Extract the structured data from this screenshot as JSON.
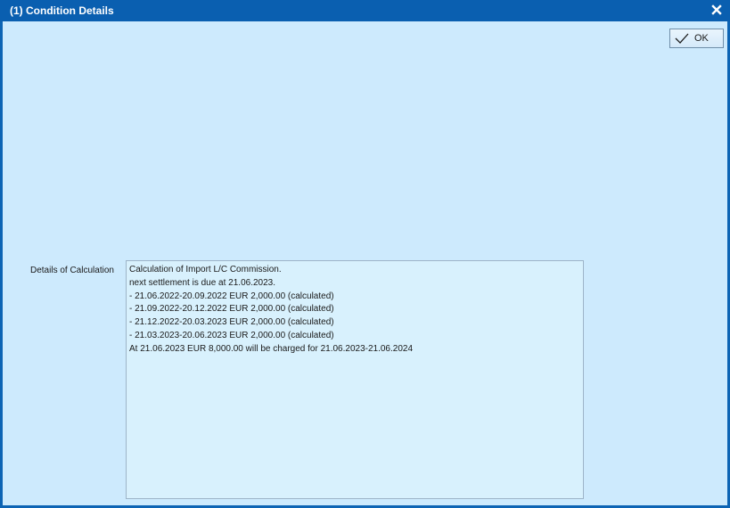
{
  "window": {
    "title": "(1) Condition Details"
  },
  "toolbar": {
    "ok_label": "OK"
  },
  "details": {
    "label": "Details of Calculation",
    "lines": [
      "Calculation of Import L/C Commission.",
      "next settlement is due at 21.06.2023.",
      "- 21.06.2022-20.09.2022 EUR 2,000.00 (calculated)",
      "- 21.09.2022-20.12.2022 EUR 2,000.00 (calculated)",
      "- 21.12.2022-20.03.2023 EUR 2,000.00 (calculated)",
      "- 21.03.2023-20.06.2023 EUR 2,000.00 (calculated)",
      "At 21.06.2023 EUR 8,000.00 will be charged for 21.06.2023-21.06.2024"
    ]
  },
  "icons": {
    "close": "close-icon",
    "ok": "checkmark-icon"
  },
  "colors": {
    "titlebar": "#0a5fb0",
    "background": "#cdeafd",
    "textarea": "#d8f1fd"
  }
}
